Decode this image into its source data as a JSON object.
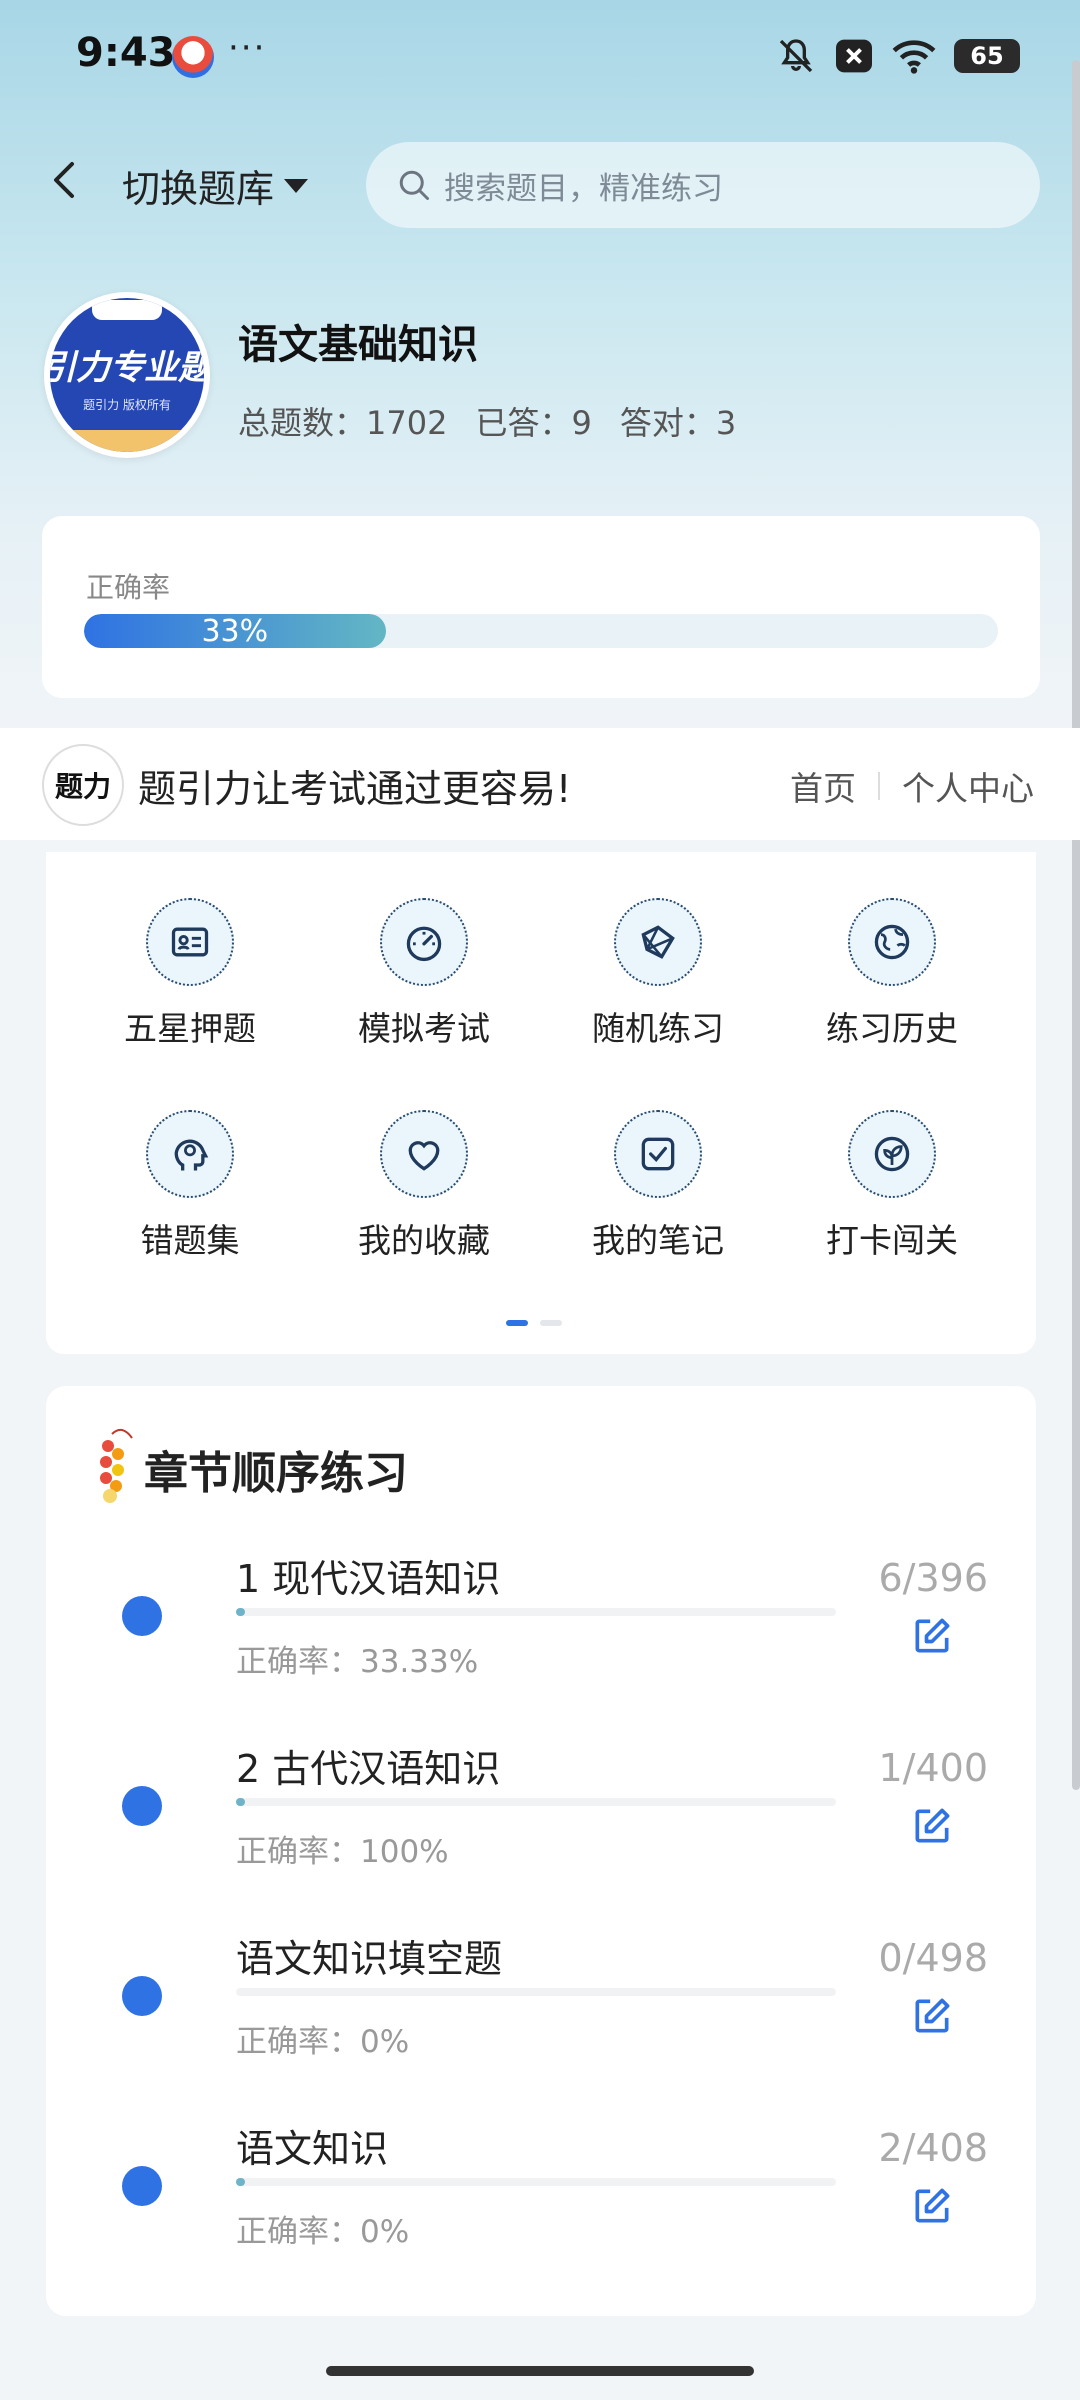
{
  "status_bar": {
    "time": "9:43",
    "dots": "···",
    "battery": "65"
  },
  "header": {
    "bank_switch_label": "切换题库",
    "search_placeholder": "搜索题目，精准练习"
  },
  "bank": {
    "logo_text": "引力专业题",
    "logo_sub": "题引力 版权所有",
    "title": "语文基础知识",
    "total_label": "总题数：1702",
    "answered_label": "已答：9",
    "correct_label": "答对：3"
  },
  "accuracy": {
    "label": "正确率",
    "value_text": "33%",
    "fraction": 0.33
  },
  "promo": {
    "logo_text": "题力",
    "text": "题引力让考试通过更容易!",
    "nav_home": "首页",
    "nav_profile": "个人中心"
  },
  "features": [
    {
      "label": "五星押题",
      "icon": "id-card-icon"
    },
    {
      "label": "模拟考试",
      "icon": "gauge-icon"
    },
    {
      "label": "随机练习",
      "icon": "network-icon"
    },
    {
      "label": "练习历史",
      "icon": "globe-icon"
    },
    {
      "label": "错题集",
      "icon": "head-icon"
    },
    {
      "label": "我的收藏",
      "icon": "heart-icon"
    },
    {
      "label": "我的笔记",
      "icon": "note-check-icon"
    },
    {
      "label": "打卡闯关",
      "icon": "leaf-icon"
    }
  ],
  "chapters": {
    "title": "章节顺序练习",
    "items": [
      {
        "name": "1 现代汉语知识",
        "accuracy": "正确率：33.33%",
        "count": "6/396",
        "progress": 0.015
      },
      {
        "name": "2 古代汉语知识",
        "accuracy": "正确率：100%",
        "count": "1/400",
        "progress": 0.0025
      },
      {
        "name": "语文知识填空题",
        "accuracy": "正确率：0%",
        "count": "0/498",
        "progress": 0
      },
      {
        "name": "语文知识",
        "accuracy": "正确率：0%",
        "count": "2/408",
        "progress": 0.005
      }
    ]
  },
  "colors": {
    "accent": "#2f72e3",
    "progress_end": "#63b7c4"
  }
}
